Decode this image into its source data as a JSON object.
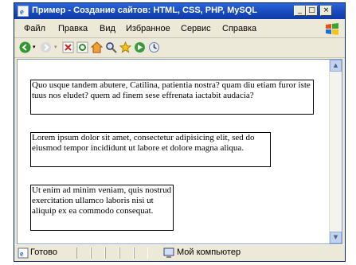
{
  "window": {
    "title": "Пример - Создание сайтов: HTML, CSS, PHP, MySQL",
    "controls": {
      "minimize": "_",
      "maximize": "□",
      "close": "×"
    }
  },
  "menu": {
    "items": [
      "Файл",
      "Правка",
      "Вид",
      "Избранное",
      "Сервис",
      "Справка"
    ]
  },
  "toolbar": {
    "icons": [
      "back-icon",
      "forward-icon",
      "stop-icon",
      "refresh-icon",
      "home-icon",
      "search-icon",
      "favorites-icon",
      "media-icon",
      "history-icon"
    ]
  },
  "content": {
    "blocks": [
      "Quo usque tandem abutere, Catilina, patientia nostra? quam diu etiam furor iste tuus nos eludet? quem ad finem sese effrenata iactabit audacia?",
      "Lorem ipsum dolor sit amet, consectetur adipisicing elit, sed do eiusmod tempor incididunt ut labore et dolore magna aliqua.",
      "Ut enim ad minim veniam, quis nostrud exercitation ullamco laboris nisi ut aliquip ex ea commodo consequat."
    ]
  },
  "status": {
    "left": "Готово",
    "right": "Мой компьютер"
  },
  "colors": {
    "titlebar": "#1c4fc4",
    "chrome": "#ece9d8"
  }
}
